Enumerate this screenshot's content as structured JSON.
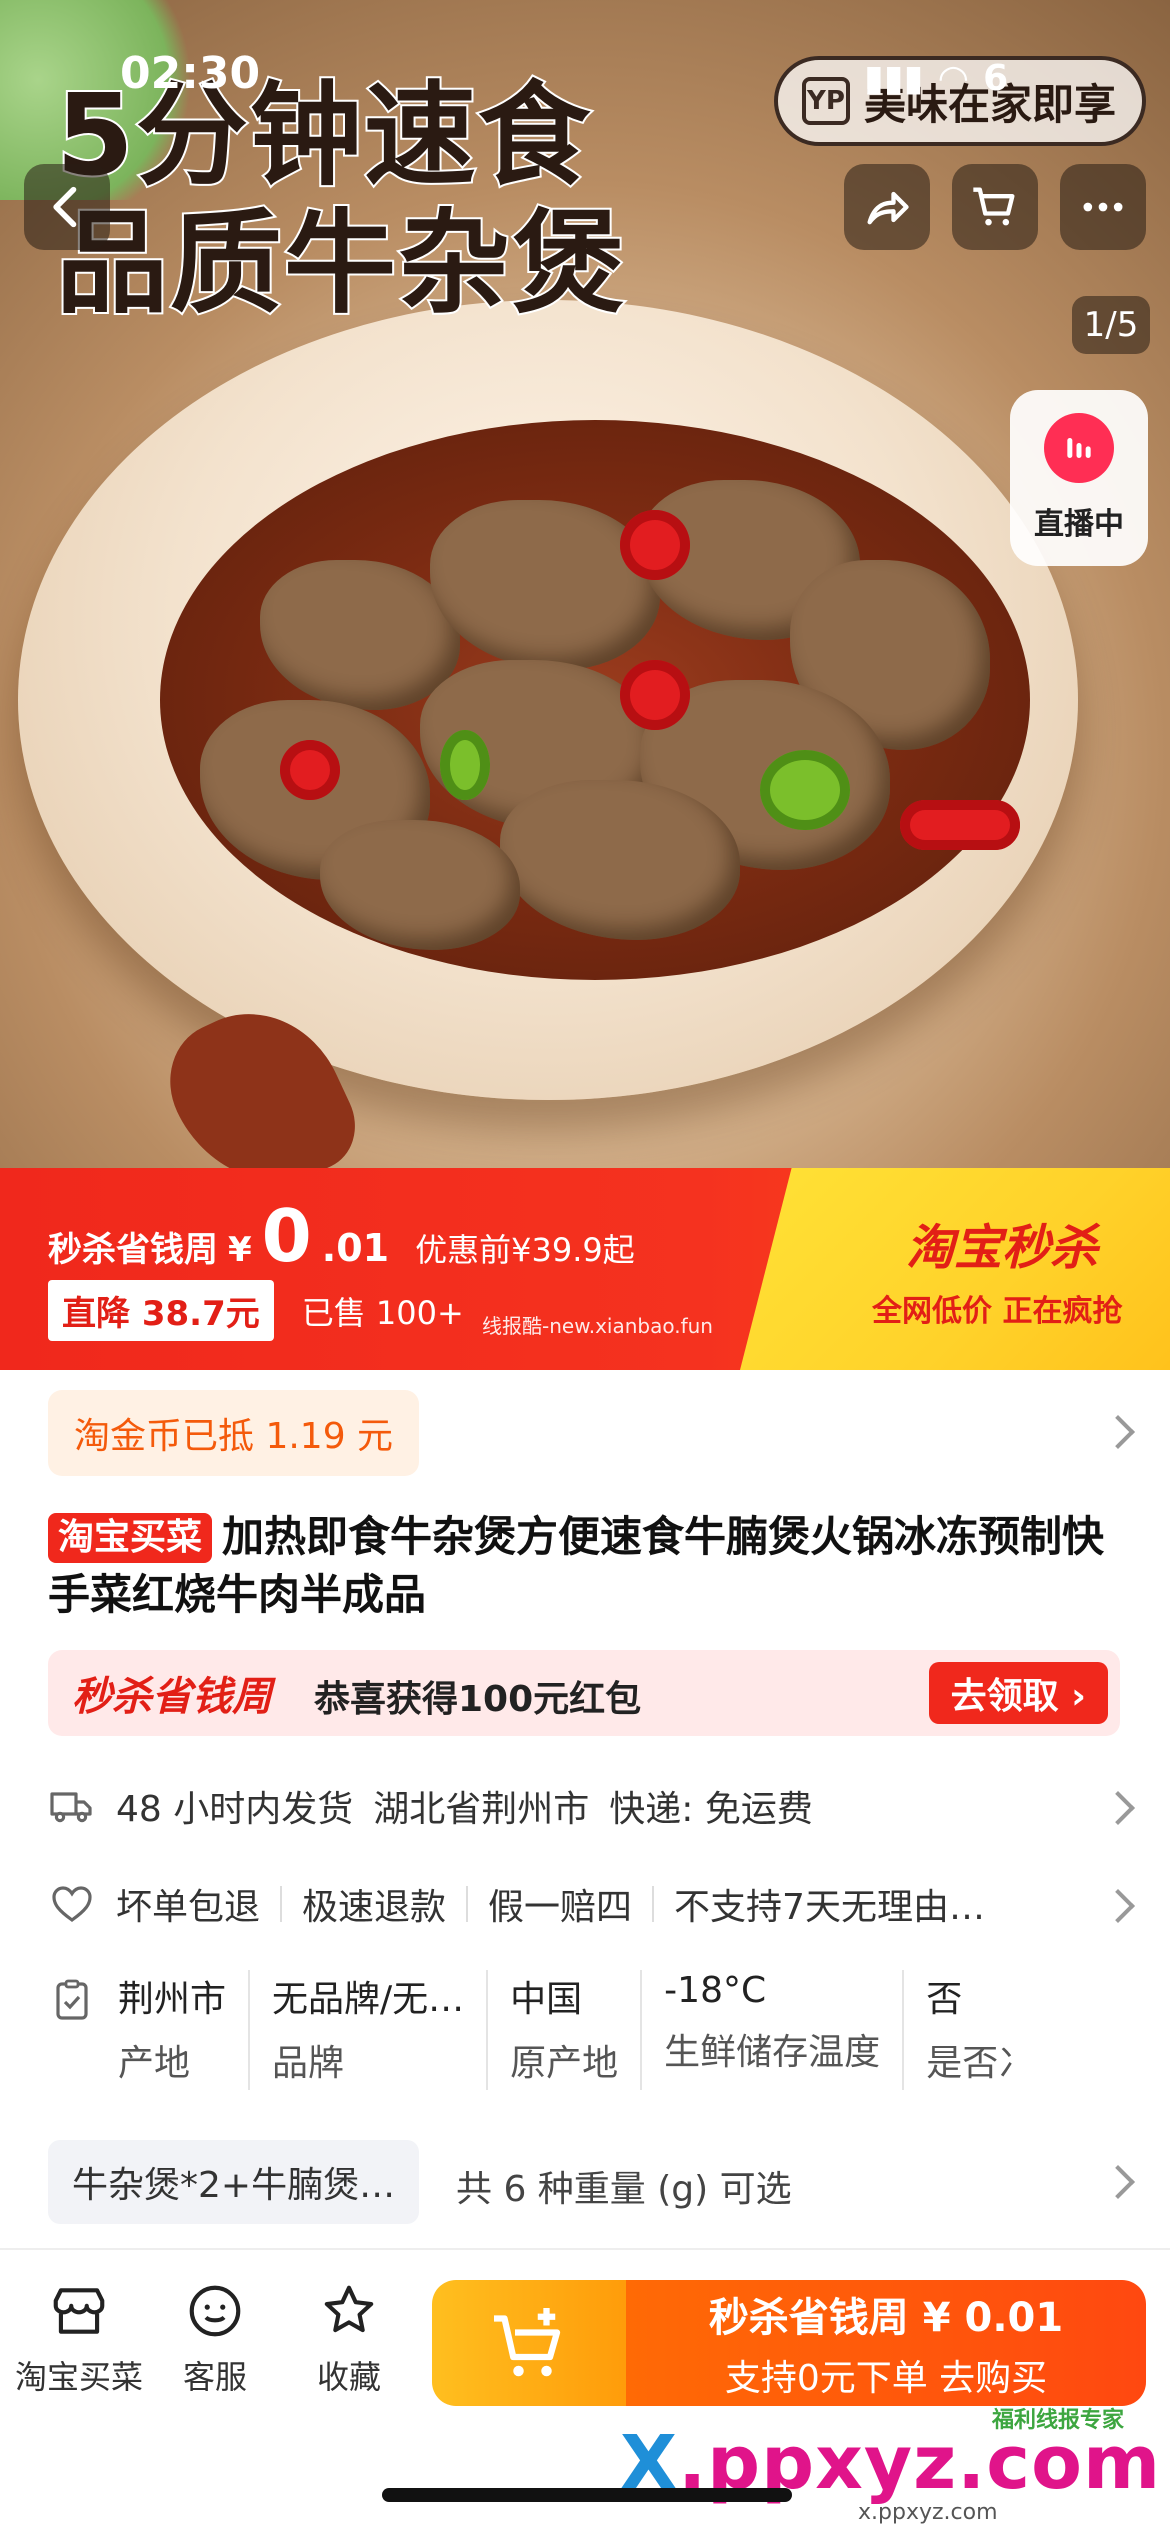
{
  "status": {
    "time": "02:30",
    "battery": "6"
  },
  "hero": {
    "title_line1": "5分钟速食",
    "title_line2": "品质牛杂煲",
    "brand_badge": "美味在家即享",
    "counter": "1/5",
    "live_label": "直播中"
  },
  "promo": {
    "label": "秒杀省钱周",
    "currency": "¥",
    "price_int": "0",
    "price_dec": ".01",
    "before_price": "优惠前¥39.9起",
    "drop": "直降 38.7元",
    "sold": "已售 100+",
    "watermark": "线报酷-new.xianbao.fun",
    "brand": "淘宝秒杀",
    "slogan": "全网低价  正在疯抢"
  },
  "coin": {
    "text": "淘金币已抵 1.19 元"
  },
  "product": {
    "tag": "淘宝买菜",
    "title": "加热即食牛杂煲方便速食牛腩煲火锅冰冻预制快手菜红烧牛肉半成品"
  },
  "redpack": {
    "title": "秒杀省钱周",
    "message": "恭喜获得100元红包",
    "button": "去领取 ›"
  },
  "shipping": {
    "time": "48 小时内发货",
    "location": "湖北省荆州市",
    "express": "快递: 免运费"
  },
  "service": {
    "items": [
      "坏单包退",
      "极速退款",
      "假一赔四",
      "不支持7天无理由…"
    ]
  },
  "params": [
    {
      "value": "荆州市",
      "key": "产地"
    },
    {
      "value": "无品牌/无…",
      "key": "品牌"
    },
    {
      "value": "中国",
      "key": "原产地"
    },
    {
      "value": "-18°C",
      "key": "生鲜储存温度"
    },
    {
      "value": "否",
      "key": "是否冫"
    }
  ],
  "sku": {
    "selected": "牛杂煲*2+牛腩煲…",
    "more": "共 6 种重量 (g) 可选"
  },
  "bottom": {
    "tab1": "淘宝买菜",
    "tab2": "客服",
    "tab3": "收藏",
    "buy_line1": "秒杀省钱周 ¥ 0.01",
    "buy_line2": "支持0元下单  去购买"
  },
  "footer": {
    "wm_x": "X",
    "wm_rest": ".ppxyz.com",
    "wm_sub": "x.ppxyz.com",
    "wm_tag": "福利线报专家"
  },
  "colors": {
    "accent_red": "#f0281c",
    "accent_orange": "#ff6a05",
    "accent_yellow": "#ffd22a"
  }
}
